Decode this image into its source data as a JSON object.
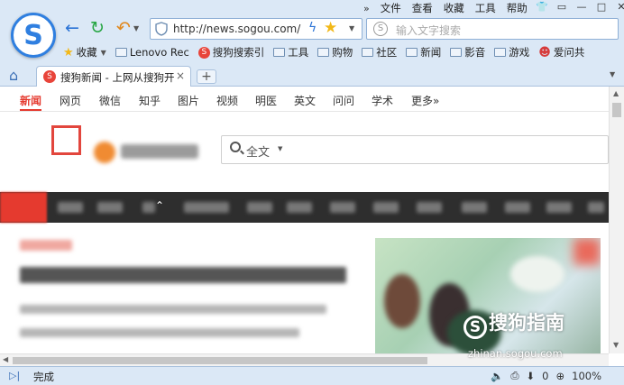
{
  "menu": {
    "items": [
      "文件",
      "查看",
      "收藏",
      "工具",
      "帮助"
    ]
  },
  "address_bar": {
    "url": "http://news.sogou.com/"
  },
  "search_box": {
    "placeholder": "输入文字搜索"
  },
  "bookmarks": [
    {
      "label": "收藏",
      "icon": "star-icon"
    },
    {
      "label": "Lenovo Rec",
      "icon": "folder-icon"
    },
    {
      "label": "搜狗搜索引",
      "icon": "sogou-icon"
    },
    {
      "label": "工具",
      "icon": "folder-icon"
    },
    {
      "label": "购物",
      "icon": "folder-icon"
    },
    {
      "label": "社区",
      "icon": "folder-icon"
    },
    {
      "label": "新闻",
      "icon": "folder-icon"
    },
    {
      "label": "影音",
      "icon": "folder-icon"
    },
    {
      "label": "游戏",
      "icon": "folder-icon"
    },
    {
      "label": "爱问共",
      "icon": "avatar-icon"
    }
  ],
  "tab": {
    "title": "搜狗新闻 - 上网从搜狗开始",
    "close": "×"
  },
  "newtab": "+",
  "vertical_nav": [
    "新闻",
    "网页",
    "微信",
    "知乎",
    "图片",
    "视频",
    "明医",
    "英文",
    "问问",
    "学术",
    "更多»"
  ],
  "site_search": {
    "scope": "全文"
  },
  "watermark": {
    "brand": "搜狗指南",
    "logo_letter": "S",
    "url": "zhinan.sogou.com"
  },
  "status": {
    "text": "完成",
    "count": "0",
    "zoom": "100%"
  },
  "colors": {
    "accent": "#e53a2f",
    "chrome": "#dbe8f6",
    "channel_bar": "#2e2e2e"
  }
}
